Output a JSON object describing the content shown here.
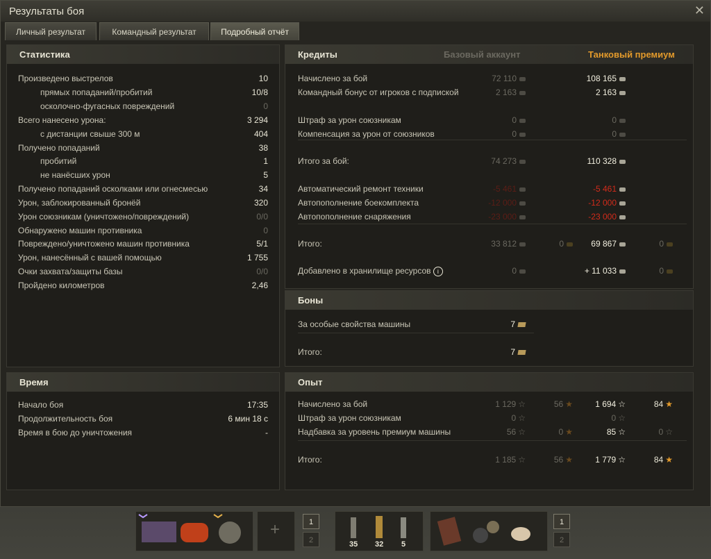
{
  "window": {
    "title": "Результаты боя"
  },
  "tabs": [
    {
      "label": "Личный результат"
    },
    {
      "label": "Командный результат"
    },
    {
      "label": "Подробный отчёт"
    }
  ],
  "stats": {
    "header": "Статистика",
    "rows": [
      {
        "label": "Произведено выстрелов",
        "value": "10"
      },
      {
        "label": "прямых попаданий/пробитий",
        "value": "10/8"
      },
      {
        "label": "осколочно-фугасных повреждений",
        "value": "0"
      },
      {
        "label": "Всего нанесено урона:",
        "value": "3 294"
      },
      {
        "label": "с дистанции свыше 300 м",
        "value": "404"
      },
      {
        "label": "Получено попаданий",
        "value": "38"
      },
      {
        "label": "пробитий",
        "value": "1"
      },
      {
        "label": "не нанёсших урон",
        "value": "5"
      },
      {
        "label": "Получено попаданий осколками или огнесмесью",
        "value": "34"
      },
      {
        "label": "Урон, заблокированный бронёй",
        "value": "320"
      },
      {
        "label": "Урон союзникам (уничтожено/повреждений)",
        "value": "0/0"
      },
      {
        "label": "Обнаружено машин противника",
        "value": "0"
      },
      {
        "label": "Повреждено/уничтожено машин противника",
        "value": "5/1"
      },
      {
        "label": "Урон, нанесённый с вашей помощью",
        "value": "1 755"
      },
      {
        "label": "Очки захвата/защиты базы",
        "value": "0/0"
      },
      {
        "label": "Пройдено километров",
        "value": "2,46"
      }
    ]
  },
  "time": {
    "header": "Время",
    "rows": [
      {
        "label": "Начало боя",
        "value": "17:35"
      },
      {
        "label": "Продолжительность боя",
        "value": "6 мин 18 с"
      },
      {
        "label": "Время в бою до уничтожения",
        "value": "-"
      }
    ]
  },
  "credits": {
    "header": "Кредиты",
    "col_base": "Базовый аккаунт",
    "col_premium": "Танковый премиум",
    "rows": [
      {
        "label": "Начислено за бой",
        "base": "72 110",
        "prem": "108 165"
      },
      {
        "label": "Командный бонус от игроков с подпиской",
        "base": "2 163",
        "prem": "2 163"
      },
      {
        "label": "Штраф за урон союзникам",
        "base": "0",
        "prem": "0"
      },
      {
        "label": "Компенсация за урон от союзников",
        "base": "0",
        "prem": "0"
      },
      {
        "label": "Итого за бой:",
        "base": "74 273",
        "prem": "110 328"
      },
      {
        "label": "Автоматический ремонт техники",
        "base": "-5 461",
        "prem": "-5 461"
      },
      {
        "label": "Автопополнение боекомплекта",
        "base": "-12 000",
        "prem": "-12 000"
      },
      {
        "label": "Автопополнение снаряжения",
        "base": "-23 000",
        "prem": "-23 000"
      },
      {
        "label": "Итого:",
        "base": "33 812",
        "base_gold": "0",
        "prem": "69 867",
        "prem_gold": "0"
      },
      {
        "label": "Добавлено в хранилище ресурсов",
        "base": "0",
        "prem": "+ 11 033",
        "prem_gold": "0"
      }
    ]
  },
  "bonds": {
    "header": "Боны",
    "rows": [
      {
        "label": "За особые свойства машины",
        "value": "7"
      },
      {
        "label": "Итого:",
        "value": "7"
      }
    ]
  },
  "xp": {
    "header": "Опыт",
    "rows": [
      {
        "label": "Начислено за бой",
        "base": "1 129",
        "base_free": "56",
        "prem": "1 694",
        "prem_free": "84"
      },
      {
        "label": "Штраф за урон союзникам",
        "base": "0",
        "prem": "0"
      },
      {
        "label": "Надбавка за уровень премиум машины",
        "base": "56",
        "base_free": "0",
        "prem": "85",
        "prem_free": "0"
      },
      {
        "label": "Итого:",
        "base": "1 185",
        "base_free": "56",
        "prem": "1 779",
        "prem_free": "84"
      }
    ]
  },
  "hotbar": {
    "add_symbol": "+",
    "ammo": [
      "35",
      "32",
      "5"
    ],
    "slot_a": [
      "1",
      "2"
    ],
    "slot_b": [
      "1",
      "2"
    ]
  }
}
